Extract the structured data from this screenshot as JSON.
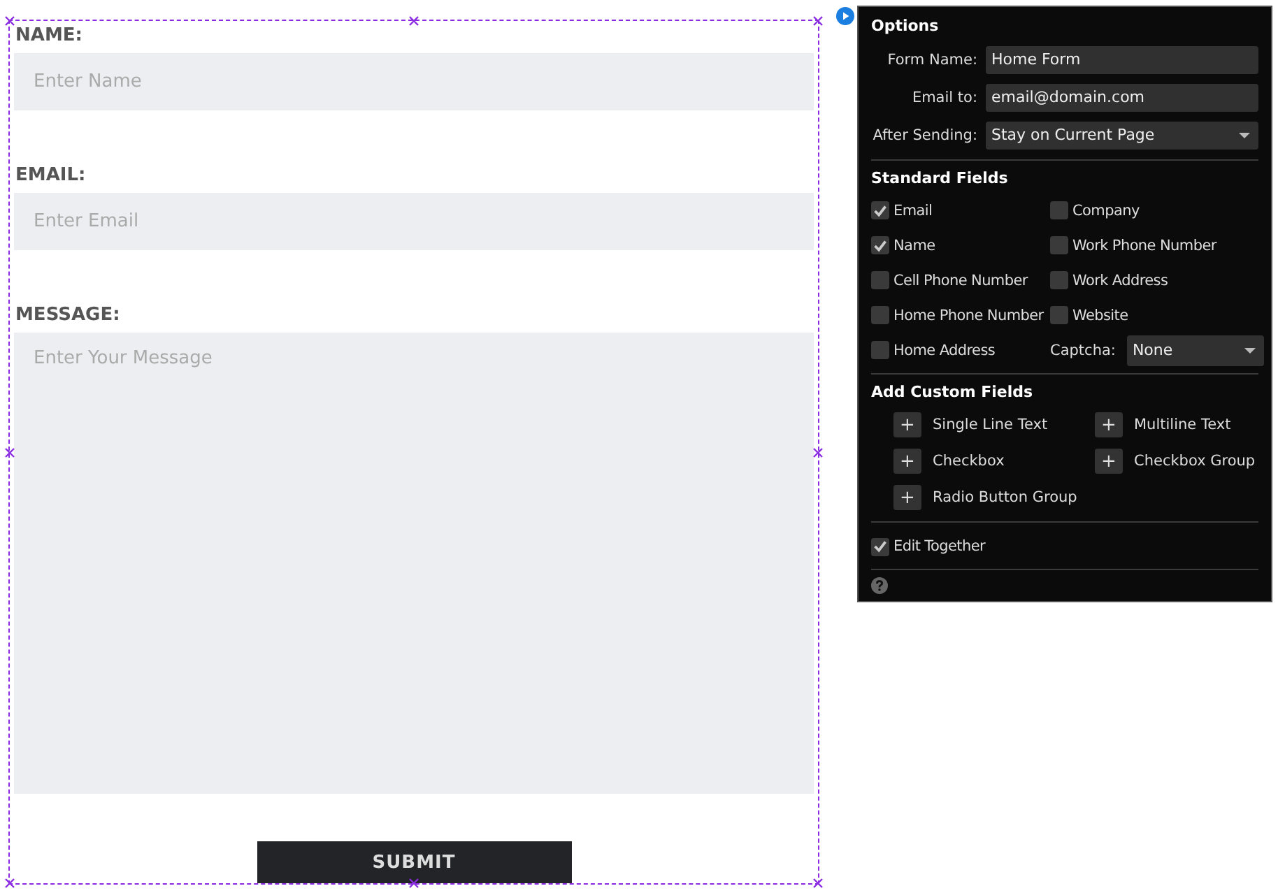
{
  "form": {
    "fields": [
      {
        "label": "NAME:",
        "placeholder": "Enter Name",
        "kind": "input"
      },
      {
        "label": "EMAIL:",
        "placeholder": "Enter Email",
        "kind": "input"
      },
      {
        "label": "MESSAGE:",
        "placeholder": "Enter Your Message",
        "kind": "textarea"
      }
    ],
    "submit": "SUBMIT"
  },
  "options": {
    "title": "Options",
    "settings": [
      {
        "label": "Form Name:",
        "value": "Home Form",
        "kind": "text"
      },
      {
        "label": "Email to:",
        "value": "email@domain.com",
        "kind": "text"
      },
      {
        "label": "After Sending:",
        "value": "Stay on Current Page",
        "kind": "select"
      }
    ],
    "standard_title": "Standard Fields",
    "standard_fields": [
      {
        "label": "Email",
        "checked": true
      },
      {
        "label": "Company",
        "checked": false
      },
      {
        "label": "Name",
        "checked": true
      },
      {
        "label": "Work Phone Number",
        "checked": false
      },
      {
        "label": "Cell Phone Number",
        "checked": false
      },
      {
        "label": "Work Address",
        "checked": false
      },
      {
        "label": "Home Phone Number",
        "checked": false
      },
      {
        "label": "Website",
        "checked": false
      },
      {
        "label": "Home Address",
        "checked": false
      }
    ],
    "captcha": {
      "label": "Captcha:",
      "value": "None"
    },
    "custom_title": "Add Custom Fields",
    "custom_fields": [
      {
        "icon": "+",
        "label": "Single Line Text"
      },
      {
        "icon": "+",
        "label": "Multiline Text"
      },
      {
        "icon": "+",
        "label": "Checkbox"
      },
      {
        "icon": "+",
        "label": "Checkbox Group"
      },
      {
        "icon": "+",
        "label": "Radio Button Group"
      }
    ],
    "edit_together": {
      "label": "Edit Together",
      "checked": true
    }
  }
}
